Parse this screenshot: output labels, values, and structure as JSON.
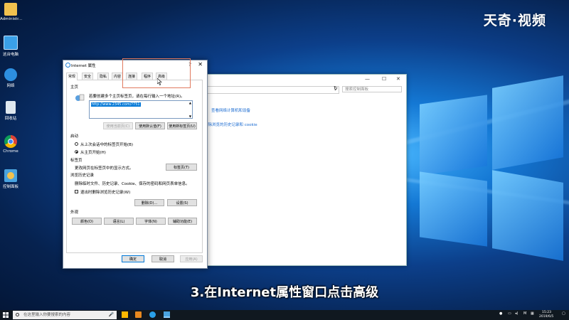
{
  "watermark": "天奇·视频",
  "subtitle": "3.在Internet属性窗口点击高级",
  "desktop_icons": [
    {
      "label": "Administr...",
      "icon": "user-folder-icon"
    },
    {
      "label": "这台电脑",
      "icon": "this-pc-icon"
    },
    {
      "label": "网络",
      "icon": "network-icon"
    },
    {
      "label": "回收站",
      "icon": "recycle-bin-icon"
    },
    {
      "label": "Chrome",
      "icon": "chrome-icon"
    },
    {
      "label": "控制面板",
      "icon": "control-panel-icon"
    }
  ],
  "bg_window": {
    "search_placeholder": "搜索控制面板",
    "link1": "查看网络计算机和设备",
    "link2": "删除浏览的历史记录和 cookie"
  },
  "dialog": {
    "title": "Internet 属性",
    "help": "?",
    "close": "✕",
    "tabs": [
      "常规",
      "安全",
      "隐私",
      "内容",
      "连接",
      "程序",
      "高级"
    ],
    "home_section": "主页",
    "home_desc": "若要创建多个主页标签页，请在每行输入一个地址(R)。",
    "home_url": "http://www.2345.com/?751",
    "btn_use_current": "使用当前页(C)",
    "btn_use_default": "使用默认值(F)",
    "btn_use_new_tab": "使用新标签页(U)",
    "startup_section": "启动",
    "startup_opt1": "从上次会话中的标签页开始(B)",
    "startup_opt2": "从主页开始(H)",
    "tabs_section": "标签页",
    "tabs_desc": "更改网页在标签页中的显示方式。",
    "btn_tabs": "标签页(T)",
    "history_section": "浏览历史记录",
    "history_desc": "删除临时文件、历史记录、Cookie、保存的密码和网页表单信息。",
    "history_check": "退出时删除浏览历史记录(W)",
    "btn_delete": "删除(D)...",
    "btn_settings": "设置(S)",
    "appearance_section": "外观",
    "btn_colors": "颜色(O)",
    "btn_languages": "语言(L)",
    "btn_fonts": "字体(N)",
    "btn_accessibility": "辅助功能(E)",
    "btn_ok": "确定",
    "btn_cancel": "取消",
    "btn_apply": "应用(A)"
  },
  "taskbar": {
    "search_placeholder": "在这里输入你要搜索的内容",
    "time": "15:23",
    "date": "2019/6/5",
    "ime": "M"
  },
  "colors": {
    "accent": "#0078d7",
    "highlight_box": "#e07a5f"
  }
}
